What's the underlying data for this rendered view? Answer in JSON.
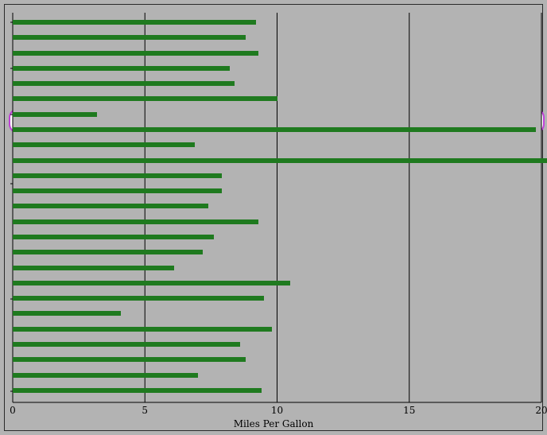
{
  "chart_data": {
    "type": "bar",
    "orientation": "horizontal",
    "xlabel": "Miles Per Gallon",
    "ylabel": "",
    "title": "",
    "xlim": [
      0,
      20
    ],
    "xticks": [
      0,
      5,
      10,
      15,
      20
    ],
    "bar_color": "#1f7a1f",
    "highlight_indices": [
      6,
      7
    ],
    "values": [
      9.2,
      8.8,
      9.3,
      8.2,
      8.4,
      10.0,
      3.2,
      19.8,
      6.9,
      20.9,
      7.9,
      7.9,
      7.4,
      9.3,
      7.6,
      7.2,
      6.1,
      10.5,
      9.5,
      4.1,
      9.8,
      8.6,
      8.8,
      7.0,
      9.4
    ]
  },
  "ticks": {
    "t0": "0",
    "t1": "5",
    "t2": "10",
    "t3": "15",
    "t4": "20"
  },
  "xlabel_text": "Miles Per Gallon"
}
